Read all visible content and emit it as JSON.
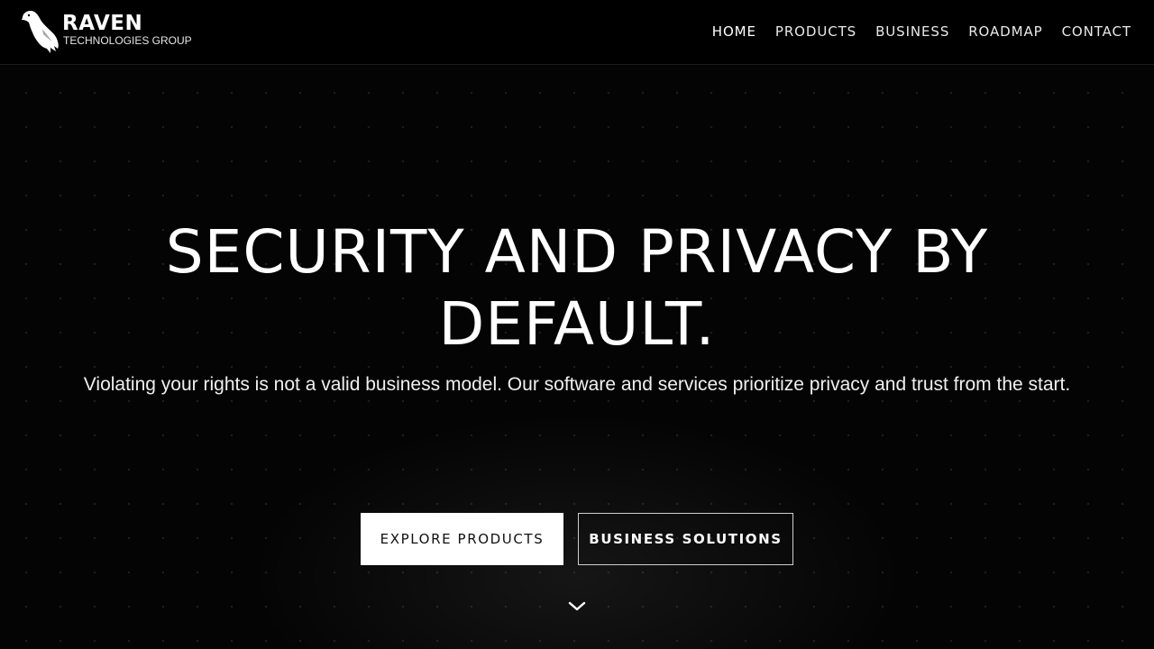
{
  "brand": {
    "name": "RAVEN",
    "subtitle": "TECHNOLOGIES GROUP",
    "logo_icon": "raven-bird-icon"
  },
  "nav": {
    "items": [
      {
        "label": "HOME"
      },
      {
        "label": "PRODUCTS"
      },
      {
        "label": "BUSINESS"
      },
      {
        "label": "ROADMAP"
      },
      {
        "label": "CONTACT"
      }
    ]
  },
  "hero": {
    "title_line1": "SECURITY AND PRIVACY BY",
    "title_line2": "DEFAULT.",
    "subtitle": "Violating your rights is not a valid business model. Our software and services prioritize privacy and trust from the start.",
    "primary_button": "EXPLORE PRODUCTS",
    "secondary_button": "BUSINESS SOLUTIONS",
    "scroll_icon": "chevron-down-icon"
  },
  "colors": {
    "background": "#040404",
    "header": "#000000",
    "text": "#ffffff",
    "primary_button_bg": "#ffffff",
    "primary_button_text": "#111111"
  }
}
